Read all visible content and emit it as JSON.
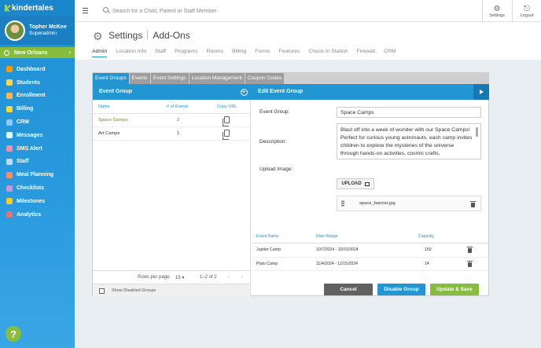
{
  "brand": {
    "name": "kindertales"
  },
  "user": {
    "name": "Topher McKee",
    "role": "Superadmin"
  },
  "location": {
    "name": "New Orleans"
  },
  "sidebar": {
    "items": [
      {
        "label": "Dashboard",
        "color": "#ff9800"
      },
      {
        "label": "Students",
        "color": "#ffd54f"
      },
      {
        "label": "Enrollment",
        "color": "#ffb74d"
      },
      {
        "label": "Billing",
        "color": "#fdd835"
      },
      {
        "label": "CRM",
        "color": "#90caf9"
      },
      {
        "label": "Messages",
        "color": "#e1f5fe"
      },
      {
        "label": "SMS Alert",
        "color": "#f48fb1"
      },
      {
        "label": "Staff",
        "color": "#bbdefb"
      },
      {
        "label": "Meal Planning",
        "color": "#ff8a65"
      },
      {
        "label": "Checklists",
        "color": "#ce93d8"
      },
      {
        "label": "Milestones",
        "color": "#ffca28"
      },
      {
        "label": "Analytics",
        "color": "#e57373"
      }
    ]
  },
  "search": {
    "placeholder": "Search for a Child, Parent or Staff Member"
  },
  "topbar": {
    "settings_label": "Settings",
    "logout_label": "Logout"
  },
  "page": {
    "title": "Settings",
    "subtitle": "Add-Ons"
  },
  "tabs": [
    "Admin",
    "Location Info",
    "Staff",
    "Programs",
    "Rooms",
    "Billing",
    "Forms",
    "Features",
    "Check-In Station",
    "Firewall",
    "CRM"
  ],
  "subtabs": [
    "Event Groups",
    "Events",
    "Event Settings",
    "Location Management",
    "Coupon Codes"
  ],
  "event_groups": {
    "header": "Event Group",
    "columns": {
      "name": "Name",
      "events": "# of Events",
      "copy": "Copy URL"
    },
    "rows": [
      {
        "name": "Space Camps",
        "count": "2"
      },
      {
        "name": "Art Camps",
        "count": "1"
      }
    ],
    "pager": {
      "rows_label": "Rows per page:",
      "rows_value": "15",
      "range": "1–2 of 2"
    },
    "show_disabled": "Show Disabled Groups"
  },
  "edit": {
    "header": "Edit Event Group",
    "group_label": "Event Group:",
    "group_value": "Space Camps",
    "description_label": "Description:",
    "description": "Blast off into a week of wonder with our Space Camps! Perfect for curious young astronauts, each camp invites children to explore the mysteries of the universe through hands-on activities, cosmic crafts,",
    "upload_label": "Upload Image:",
    "upload_button": "UPLOAD",
    "file_name": "space_banner.jpg",
    "events_columns": {
      "name": "Event Name",
      "range": "Date Range",
      "capacity": "Capacity"
    },
    "events": [
      {
        "name": "Jupiter Camp",
        "range": "10/7/2024 - 10/31/2024",
        "capacity": "150"
      },
      {
        "name": "Pluto Camp",
        "range": "11/4/2024 - 11/15/2024",
        "capacity": "14"
      }
    ],
    "buttons": {
      "cancel": "Cancel",
      "disable": "Disable Group",
      "update": "Update & Save"
    }
  },
  "colors": {
    "primary": "#2196d3",
    "accent": "#86bd3e",
    "cancel": "#616161"
  }
}
